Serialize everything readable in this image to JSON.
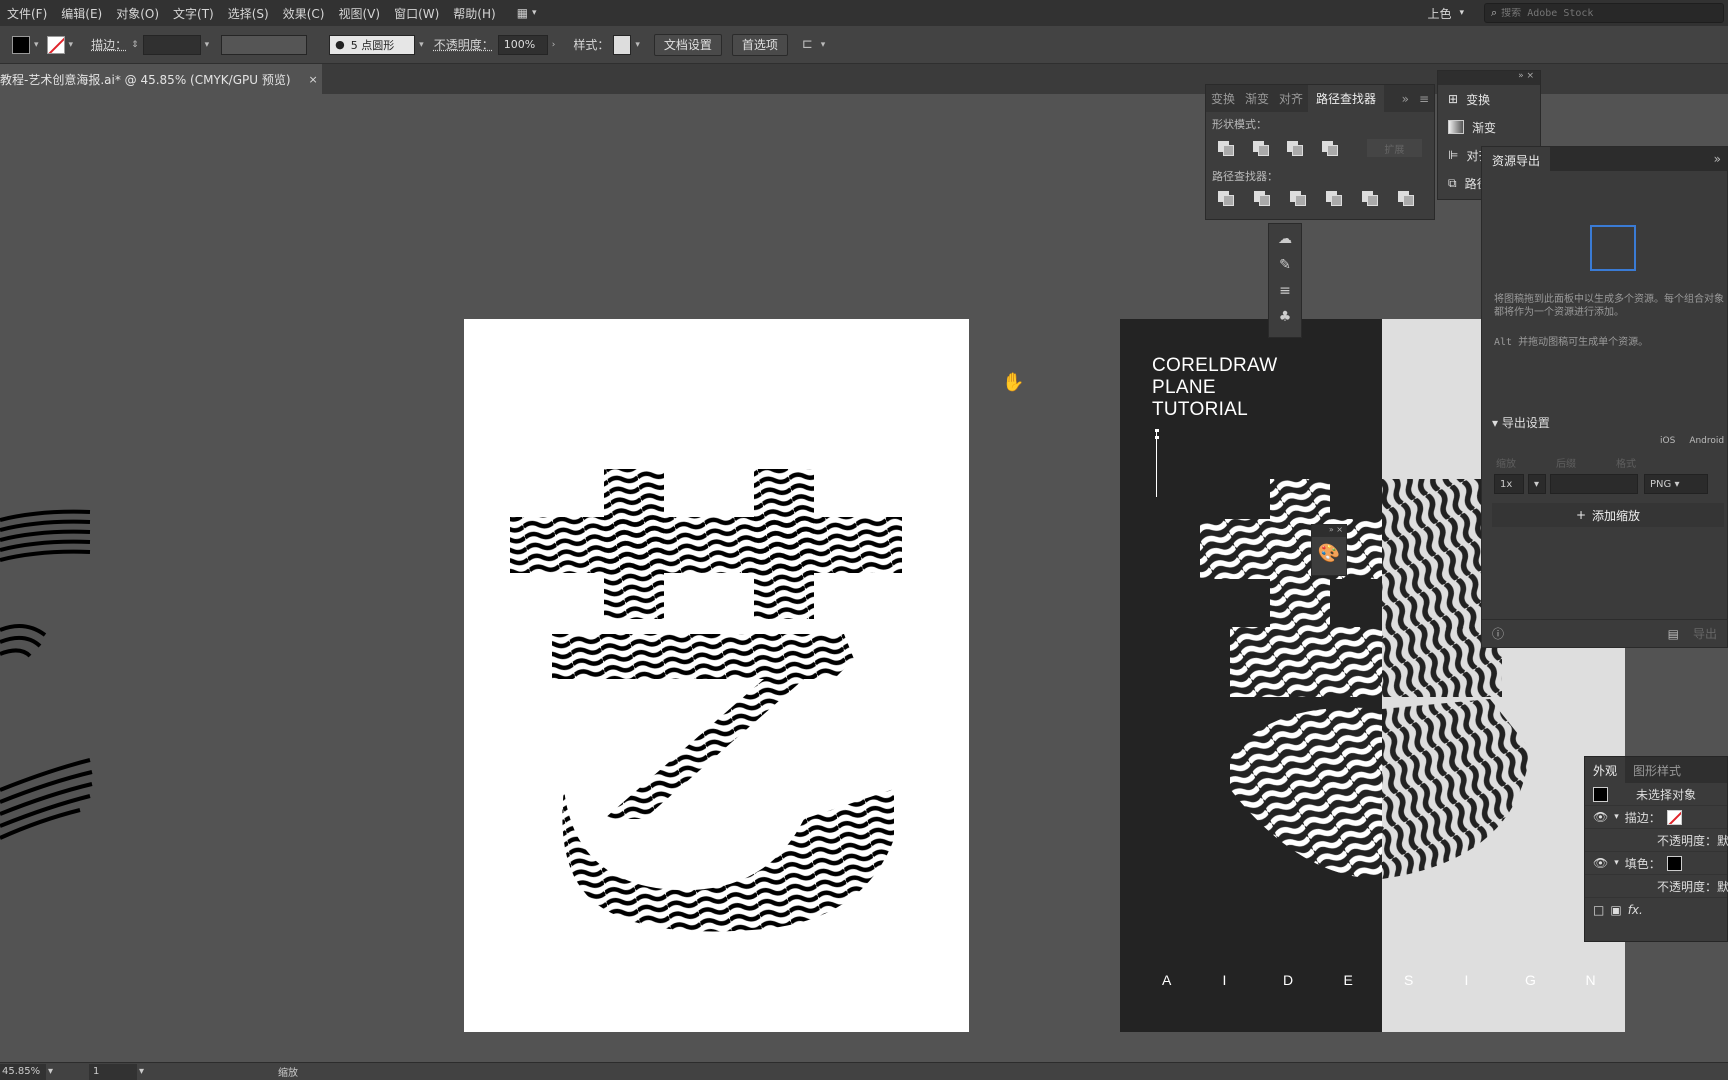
{
  "menubar": {
    "items": [
      "文件(F)",
      "编辑(E)",
      "对象(O)",
      "文字(T)",
      "选择(S)",
      "效果(C)",
      "视图(V)",
      "窗口(W)",
      "帮助(H)"
    ],
    "workspace": "上色",
    "search_placeholder": "搜索 Adobe Stock"
  },
  "controlbar": {
    "stroke_label": "描边：",
    "brush": "5 点圆形",
    "opacity_label": "不透明度：",
    "opacity_value": "100%",
    "style_label": "样式：",
    "doc_setup": "文档设置",
    "preferences": "首选项"
  },
  "document": {
    "tab_title": "教程-艺术创意海报.ai* @ 45.85% (CMYK/GPU 预览)",
    "close": "×"
  },
  "poster": {
    "title": "CORELDRAW\nPLANE\nTUTORIAL",
    "bottom_letters": [
      "A",
      "I",
      "D",
      "E",
      "S",
      "I",
      "G",
      "N"
    ]
  },
  "pathfinder": {
    "tabs": [
      "变换",
      "渐变",
      "对齐",
      "路径查找器"
    ],
    "active_tab": "路径查找器",
    "shape_modes": "形状模式：",
    "expand": "扩展",
    "pathfinders": "路径查找器："
  },
  "dock": {
    "items": [
      "变换",
      "渐变",
      "对齐",
      "路径查找器"
    ]
  },
  "asset_export": {
    "tab": "资源导出",
    "hint": "将图稿拖到此面板中以生成多个资源。每个组合对象都将作为一个资源进行添加。",
    "hint2": "Alt 并拖动图稿可生成单个资源。",
    "export_settings": "导出设置",
    "platforms": [
      "iOS",
      "Android"
    ],
    "col_labels": [
      "缩放",
      "后缀",
      "格式"
    ],
    "scale": "1x",
    "format": "PNG",
    "add_scale": "添加缩放",
    "export_btn": "导出"
  },
  "appearance": {
    "tabs": [
      "外观",
      "图形样式"
    ],
    "no_selection": "未选择对象",
    "stroke": "描边：",
    "opacity": "不透明度：默认值",
    "fill": "填色：",
    "opacity2": "不透明度：默认值",
    "fx": "fx."
  },
  "statusbar": {
    "zoom": "45.85%",
    "page": "1",
    "mode": "缩放"
  },
  "colors": {
    "menu_bg": "#323232",
    "canvas_bg": "#535353",
    "panel_bg": "#3b3b3b",
    "accent_blue": "#3a7bd5"
  }
}
